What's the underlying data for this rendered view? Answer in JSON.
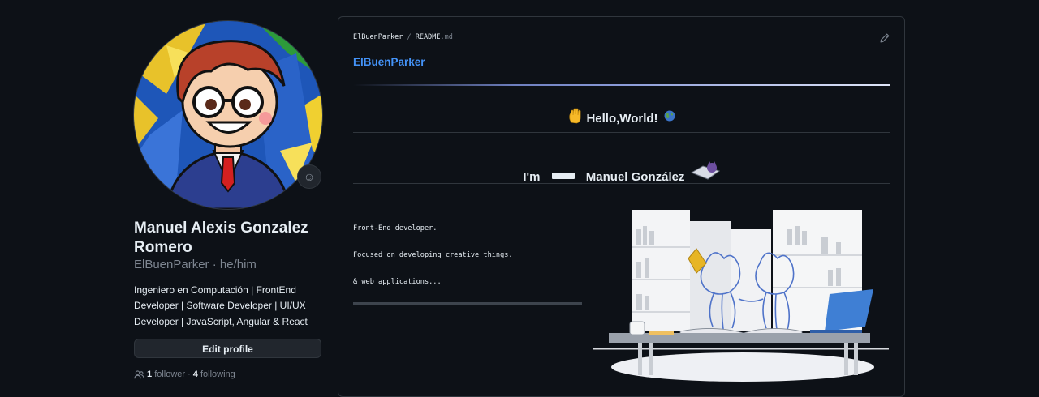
{
  "profile": {
    "full_name": "Manuel Alexis Gonzalez Romero",
    "login": "ElBuenParker",
    "pronouns": "he/him",
    "bio": "Ingeniero en Computación | FrontEnd Developer | Software Developer | UI/UX Developer | JavaScript, Angular & React",
    "edit_label": "Edit profile",
    "followers_count": "1",
    "followers_label": "follower",
    "dot": "·",
    "following_count": "4",
    "following_label": "following"
  },
  "readme": {
    "path_user": "ElBuenParker",
    "path_sep": "/",
    "path_file": "README",
    "path_ext": ".md",
    "repo_link": "ElBuenParker",
    "heading_hello": "Hello,World!",
    "heading_im": "I'm",
    "heading_name": "Manuel González",
    "lines": [
      "Front-End developer.",
      "Focused on developing creative things.",
      "& web applications..."
    ]
  },
  "icons": {
    "smiley": "smiley-icon",
    "pencil": "pencil-icon",
    "people": "people-icon",
    "wave": "waving-hand-icon",
    "globe": "globe-icon"
  },
  "colors": {
    "background": "#0d1117",
    "link": "#4493f8",
    "muted": "#7d8590",
    "border": "#30363d"
  }
}
